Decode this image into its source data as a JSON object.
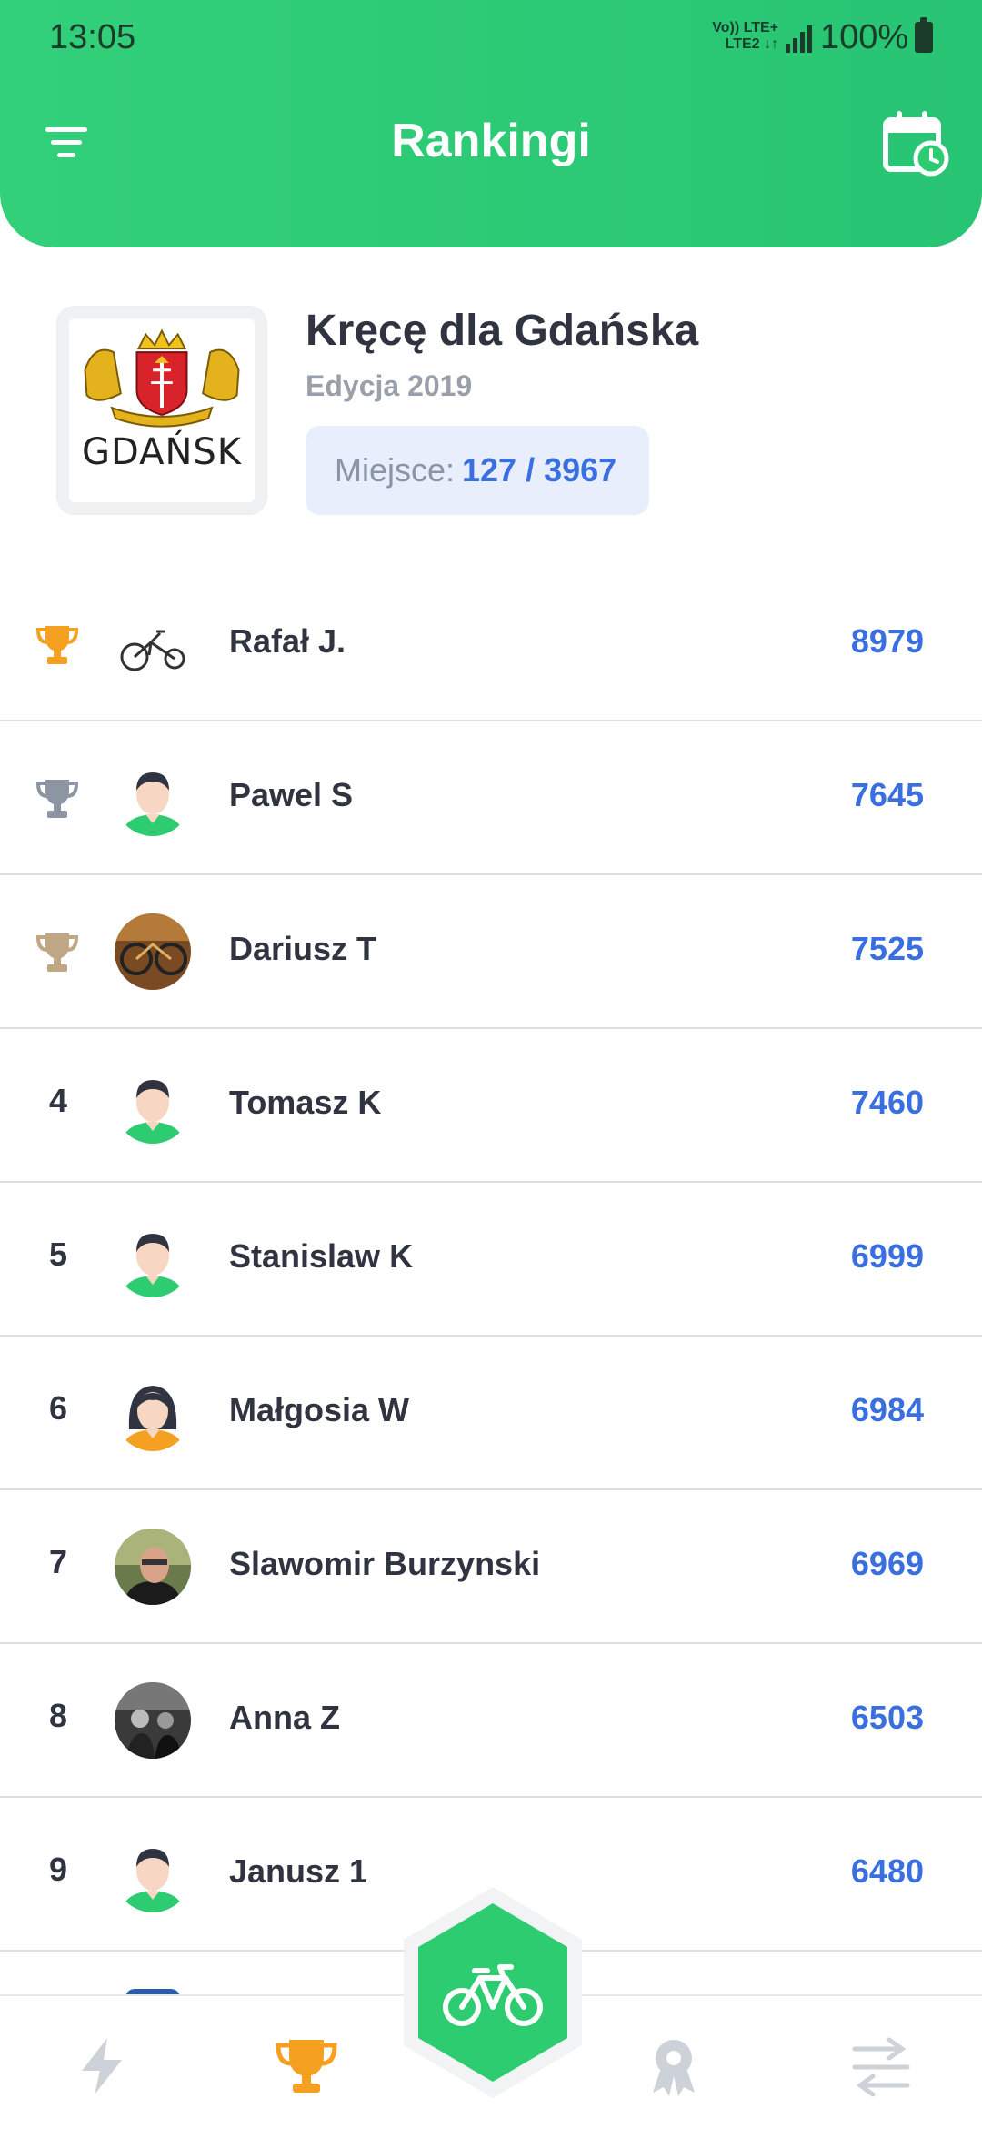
{
  "status_bar": {
    "time": "13:05",
    "network_top": "Vo)) LTE+",
    "network_bottom": "LTE2 ↓↑",
    "battery": "100%"
  },
  "header": {
    "title": "Rankingi",
    "filter_icon": "filter-icon",
    "calendar_icon": "calendar-clock-icon"
  },
  "event": {
    "logo_text": "GDAŃSK",
    "title": "Kręcę dla Gdańska",
    "edition": "Edycja 2019",
    "place_label": "Miejsce:",
    "place_value": "127 / 3967"
  },
  "ranking": [
    {
      "position": "",
      "trophy": "gold",
      "name": "Rafał J.",
      "score": "8979",
      "avatar": "bike-photo"
    },
    {
      "position": "",
      "trophy": "silver",
      "name": "Pawel S",
      "score": "7645",
      "avatar": "male-default"
    },
    {
      "position": "",
      "trophy": "bronze",
      "name": "Dariusz T",
      "score": "7525",
      "avatar": "bike-photo-2"
    },
    {
      "position": "4",
      "trophy": "",
      "name": "Tomasz K",
      "score": "7460",
      "avatar": "male-default"
    },
    {
      "position": "5",
      "trophy": "",
      "name": "Stanislaw K",
      "score": "6999",
      "avatar": "male-default"
    },
    {
      "position": "6",
      "trophy": "",
      "name": "Małgosia W",
      "score": "6984",
      "avatar": "female-default"
    },
    {
      "position": "7",
      "trophy": "",
      "name": "Slawomir Burzynski",
      "score": "6969",
      "avatar": "person-photo"
    },
    {
      "position": "8",
      "trophy": "",
      "name": "Anna Z",
      "score": "6503",
      "avatar": "group-photo"
    },
    {
      "position": "9",
      "trophy": "",
      "name": "Janusz 1",
      "score": "6480",
      "avatar": "male-default"
    }
  ],
  "colors": {
    "primary_green": "#2ecc71",
    "score_blue": "#3a6fe0",
    "gold": "#f5a020",
    "silver": "#8d95a3",
    "bronze": "#bfa785",
    "nav_active": "#f5a020",
    "nav_inactive": "#cdd2d9"
  },
  "bottom_nav": {
    "items": [
      "lightning-icon",
      "trophy-icon",
      "ride-bike-icon",
      "award-icon",
      "transfer-icon"
    ],
    "active": "trophy-icon"
  }
}
